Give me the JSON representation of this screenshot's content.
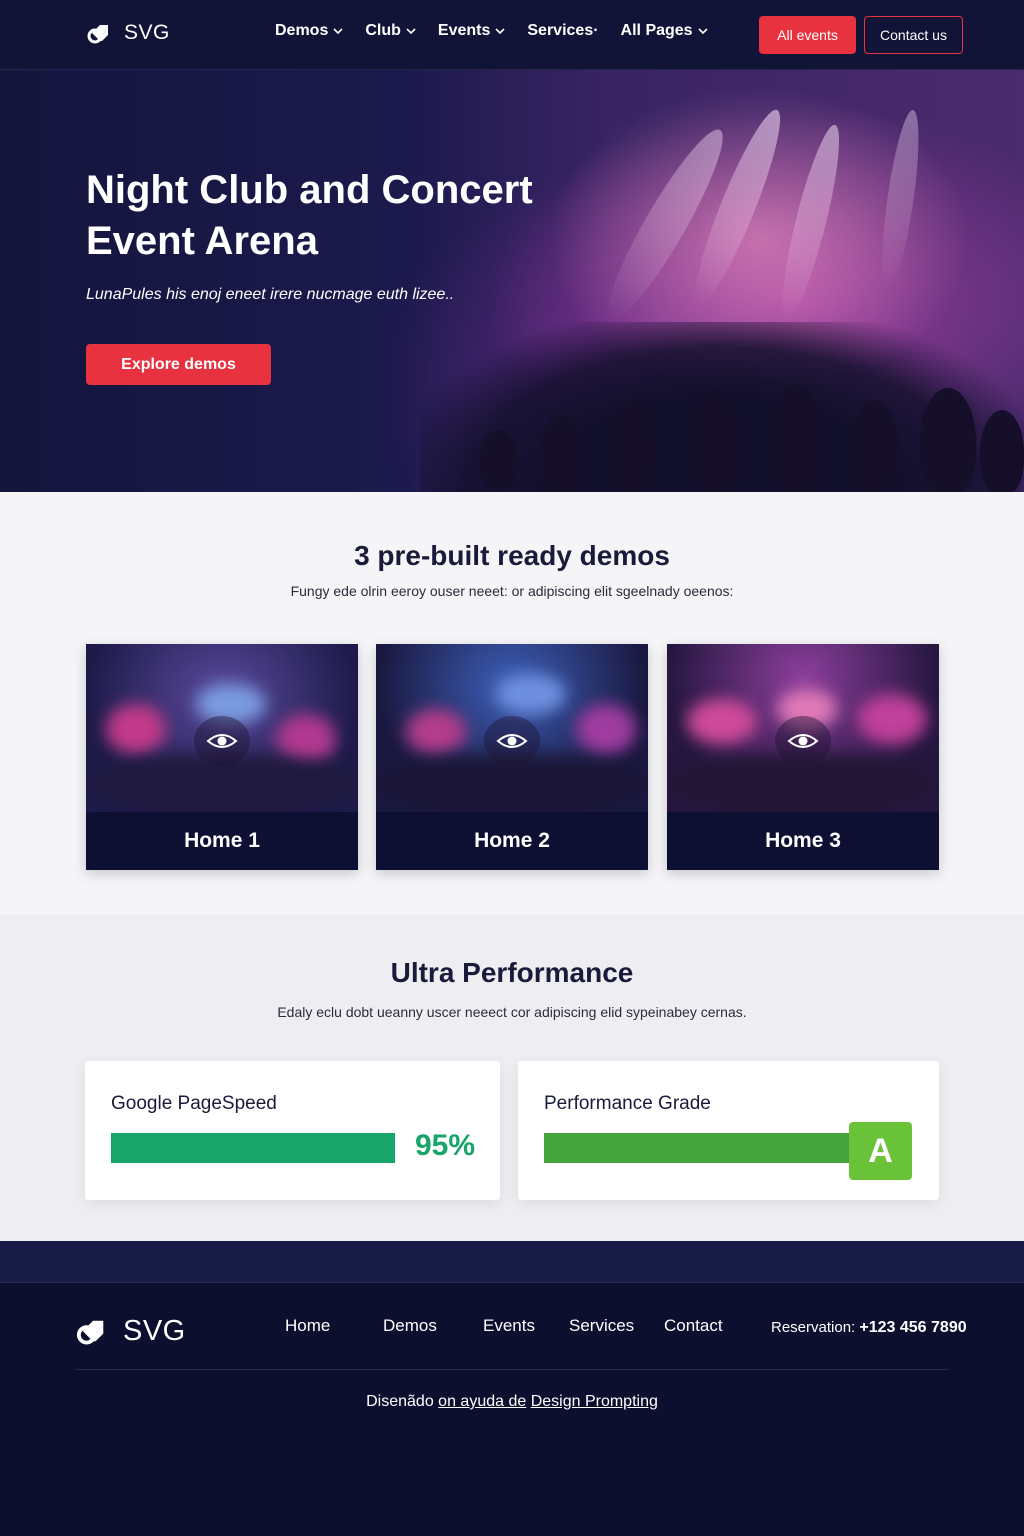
{
  "brand": {
    "logo_text": "SVG",
    "accent": "#e8323f",
    "navy": "#0d0f2e"
  },
  "nav": {
    "items": [
      {
        "label": "Demos",
        "has_dropdown": true
      },
      {
        "label": "Club",
        "has_dropdown": true
      },
      {
        "label": "Events",
        "has_dropdown": true
      },
      {
        "label": "Services·",
        "has_dropdown": false
      },
      {
        "label": "All Pages",
        "has_dropdown": true
      }
    ],
    "all_events_label": "All events",
    "contact_label": "Contact us"
  },
  "hero": {
    "title": "Night Club and Concert Event Arena",
    "subtitle": "LunaPules his enoj eneet irere nucmage euth lizee..",
    "cta_label": "Explore demos"
  },
  "demos": {
    "title": "3 pre-built ready demos",
    "subtitle": "Fungy ede olrin eeroy  ouser neeet:  or adipiscing elit sgeelnady oeenos:",
    "cards": [
      {
        "label": "Home 1",
        "icon": "eye-icon"
      },
      {
        "label": "Home 2",
        "icon": "eye-icon"
      },
      {
        "label": "Home 3",
        "icon": "eye-icon"
      }
    ]
  },
  "performance": {
    "title": "Ultra Performance",
    "subtitle": "Edaly eclu dobt ueanny uscer neeect cor adipiscing elid sypeinabey cernas.",
    "pagespeed": {
      "title": "Google PageSpeed",
      "value_label": "95%",
      "value": 0.95,
      "color": "#17a56a"
    },
    "grade": {
      "title": "Performance Grade",
      "grade_label": "A",
      "color": "#46a43c",
      "badge_color": "#6ac238"
    }
  },
  "footer": {
    "logo_text": "SVG",
    "links": [
      "Home",
      "Demos",
      "Events",
      "Services",
      "Contact"
    ],
    "reservation_label": "Reservation:",
    "reservation_phone": "+123 456 7890",
    "credit_prefix": "Disenãdo ",
    "credit_link1": "on ayuda de",
    "credit_link2": "Design Prompting"
  }
}
